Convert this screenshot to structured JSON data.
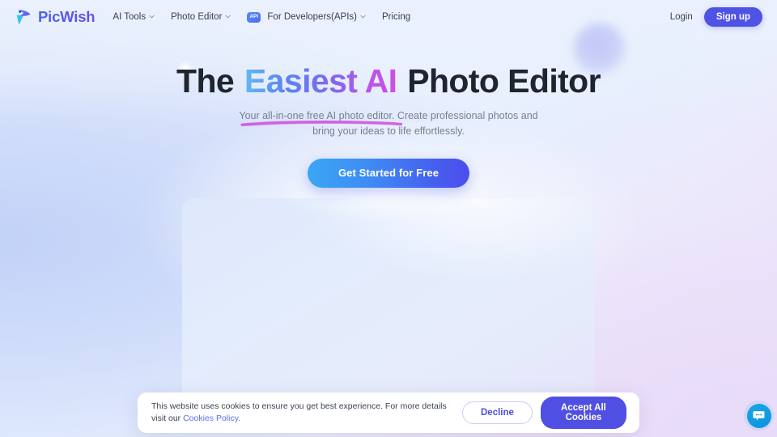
{
  "header": {
    "brand": {
      "name": "PicWish",
      "logo_icon": "picwish-bird-logo"
    },
    "nav": [
      {
        "label": "AI Tools",
        "has_chevron": true,
        "badge": null
      },
      {
        "label": "Photo Editor",
        "has_chevron": true,
        "badge": null
      },
      {
        "label": "For Developers(APIs)",
        "has_chevron": true,
        "badge": "API"
      },
      {
        "label": "Pricing",
        "has_chevron": false,
        "badge": null
      }
    ],
    "login_label": "Login",
    "signup_label": "Sign up"
  },
  "hero": {
    "headline_part1": "The ",
    "headline_highlight": "Easiest AI",
    "headline_part2": " Photo Editor",
    "subtitle_line1": "Your all-in-one free AI photo editor. Create professional photos and",
    "subtitle_line2": "bring your ideas to life effortlessly.",
    "cta_label": "Get Started for Free"
  },
  "cookie": {
    "text_before_link": "This website uses cookies to ensure you get best experience. For more details visit our ",
    "link_label": "Cookies Policy.",
    "decline_label": "Decline",
    "accept_label": "Accept All Cookies"
  },
  "chat": {
    "icon": "chat-bubble-icon"
  },
  "colors": {
    "brand_indigo": "#4f53e4",
    "cta_gradient_start": "#3aa7f5",
    "cta_gradient_end": "#4d4ced",
    "highlight_gradient_start": "#66b9f2",
    "highlight_gradient_end": "#cf4fe6",
    "underline": "#cf56e0",
    "chat_blue": "#0c93de",
    "link_blue": "#5b6ff0"
  }
}
